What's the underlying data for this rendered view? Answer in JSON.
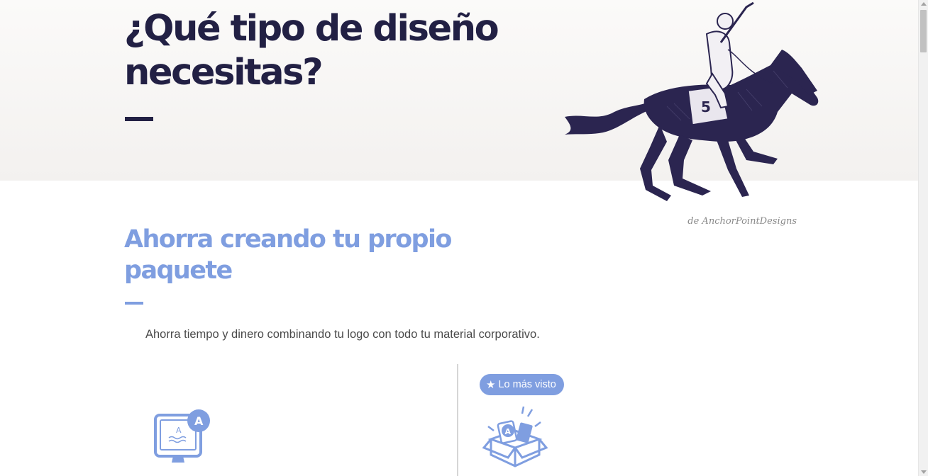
{
  "hero": {
    "title": "¿Qué tipo de diseño necesitas?",
    "image_credit": "de AnchorPointDesigns"
  },
  "section": {
    "title": "Ahorra creando tu propio paquete",
    "description": "Ahorra tiempo y dinero combinando tu logo con todo tu material corporativo."
  },
  "cards": [
    {
      "icon": "logo-monitor-icon"
    },
    {
      "icon": "package-box-icon",
      "badge_label": "Lo más visto",
      "badge_icon": "star-icon"
    }
  ],
  "colors": {
    "hero_text": "#222044",
    "accent": "#7f9ee0",
    "hero_bg": "#f3f1ef"
  }
}
